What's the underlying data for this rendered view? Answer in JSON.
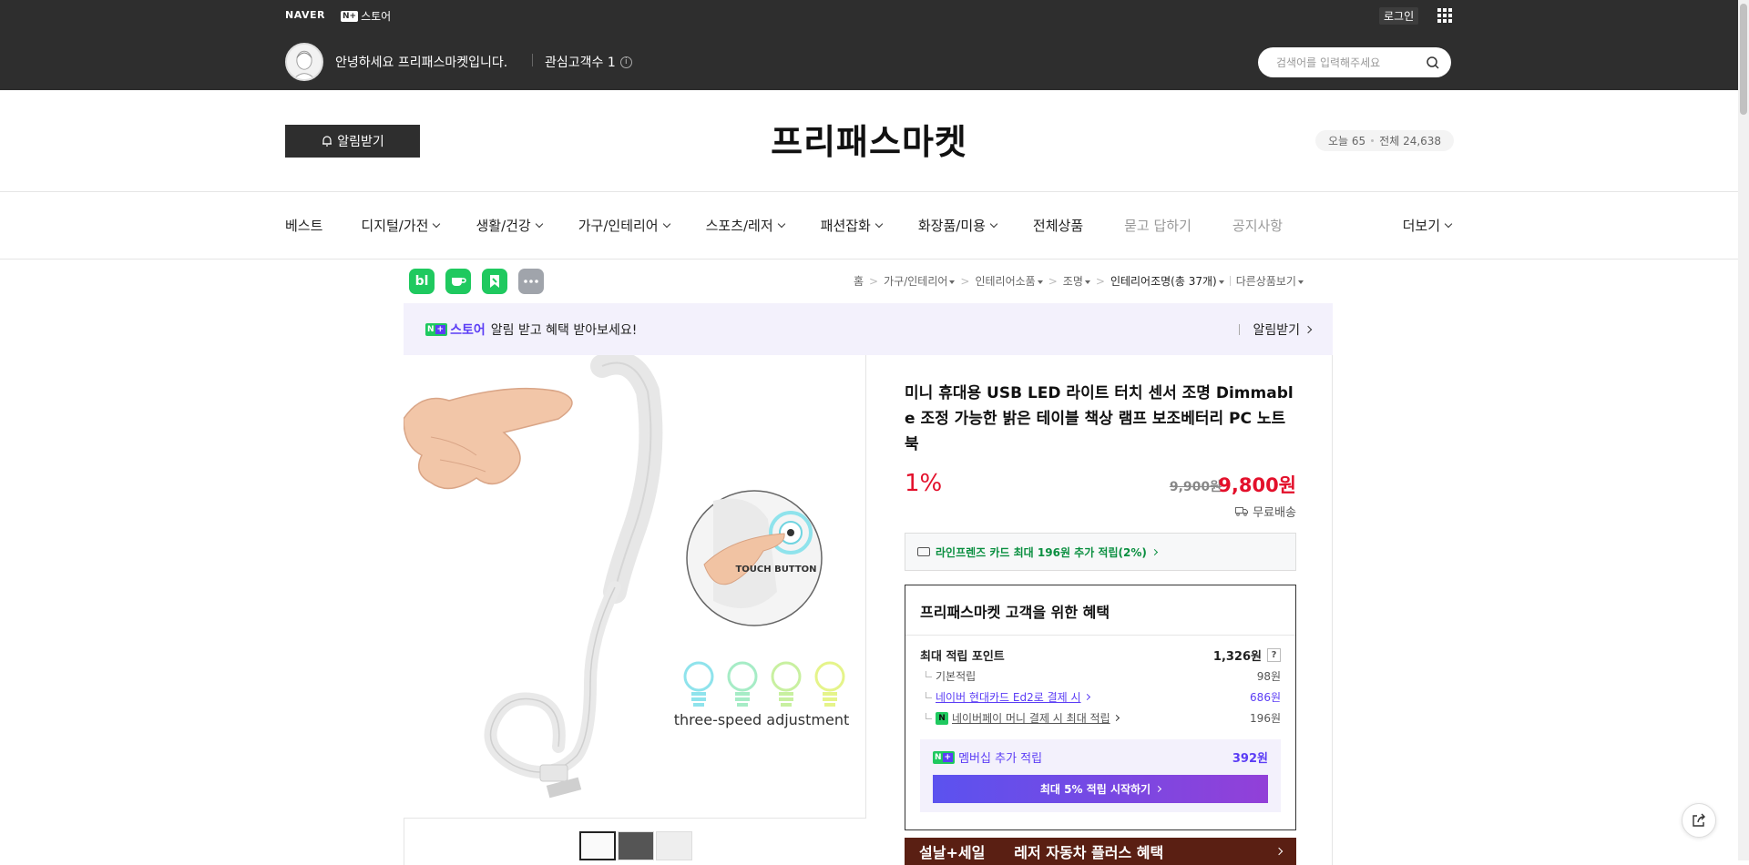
{
  "topbar": {
    "naver": "NAVER",
    "nplus": "N+",
    "store": "스토어",
    "login": "로그인",
    "greeting": "안녕하세요 프리패스마켓입니다.",
    "fans": "관심고객수 1",
    "search_placeholder": "검색어를 입력해주세요"
  },
  "header": {
    "alarm": "알림받기",
    "store_name": "프리패스마켓",
    "today": "오늘 65",
    "total": "전체 24,638"
  },
  "nav": {
    "items": [
      "베스트",
      "디지털/가전",
      "생활/건강",
      "가구/인테리어",
      "스포츠/레저",
      "패션잡화",
      "화장품/미용",
      "전체상품",
      "묻고 답하기",
      "공지사항",
      "더보기"
    ]
  },
  "share": {
    "blog": "bl"
  },
  "breadcrumb": {
    "home": "홈",
    "c1": "가구/인테리어",
    "c2": "인테리어소품",
    "c3": "조명",
    "c4": "인테리어조명(총 37개)",
    "other": "다른상품보기"
  },
  "promo": {
    "brand": "스토어",
    "message": "알림 받고 혜택 받아보세요!",
    "action": "알림받기"
  },
  "product": {
    "title": "미니 휴대용 USB LED 라이트 터치 센서 조명 Dimmable 조정 가능한 밝은 테이블 책상 램프 보조베터리 PC 노트북",
    "discount": "1%",
    "original_price": "9,900원",
    "sale_price": "9,800원",
    "shipping": "무료배송",
    "card_benefit": "라인프렌즈 카드 최대 196원 추가 적립(2%)",
    "image_text_touch": "TOUCH BUTTON",
    "image_text_speed": "three-speed adjustment"
  },
  "benefit": {
    "title": "프리패스마켓 고객을 위한 혜택",
    "max_point_label": "최대 적립 포인트",
    "max_point_value": "1,326원",
    "basic_label": "기본적립",
    "basic_value": "98원",
    "hyundai_label": "네이버 현대카드 Ed2로 결제 시",
    "hyundai_value": "686원",
    "npay_label": "네이버페이 머니 결제 시 최대 적립",
    "npay_value": "196원",
    "member_label": "멤버십 추가 적립",
    "member_value": "392원",
    "cta": "최대 5% 적립 시작하기"
  },
  "ad": {
    "left": "설날+세일",
    "right": "레저 자동차 플러스 혜택"
  },
  "colors": {
    "dark": "#2e2e2e",
    "price_red": "#e3102b",
    "naver_green": "#1fc95f",
    "plus_purple": "#5b3df5"
  }
}
